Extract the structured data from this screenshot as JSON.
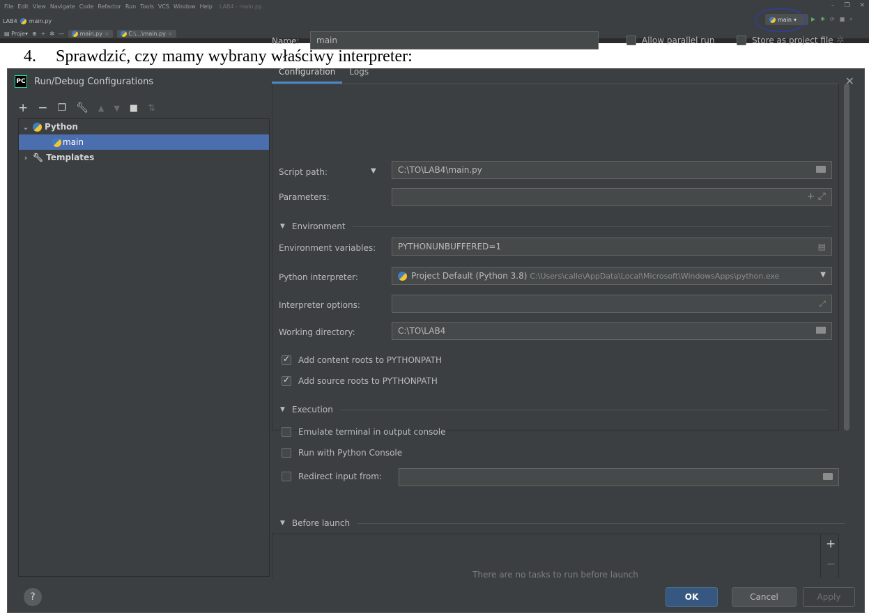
{
  "ide": {
    "menu": [
      "File",
      "Edit",
      "View",
      "Navigate",
      "Code",
      "Refactor",
      "Run",
      "Tools",
      "VCS",
      "Window",
      "Help"
    ],
    "window_title": "LAB4 - main.py",
    "breadcrumb": [
      "LAB4",
      "main.py"
    ],
    "project_label": "Proje",
    "tabs": [
      "main.py",
      "C:\\...\\main.py"
    ],
    "run_config": "main"
  },
  "document": {
    "step_number": "4.",
    "step_text": "Sprawdzić, czy mamy wybrany właściwy interpreter:"
  },
  "dialog": {
    "title": "Run/Debug Configurations",
    "tree": {
      "python": "Python",
      "main": "main",
      "templates": "Templates"
    },
    "name_label": "Name:",
    "name_value": "main",
    "allow_parallel_run": "Allow parallel run",
    "store_as_project_file": "Store as project file",
    "tabs": [
      "Configuration",
      "Logs"
    ],
    "config": {
      "script_path_label": "Script path:",
      "script_path": "C:\\TO\\LAB4\\main.py",
      "parameters_label": "Parameters:",
      "environment_section": "Environment",
      "env_vars_label": "Environment variables:",
      "env_vars": "PYTHONUNBUFFERED=1",
      "interpreter_label": "Python interpreter:",
      "interpreter": "Project Default (Python 3.8)",
      "interpreter_path": "C:\\Users\\calle\\AppData\\Local\\Microsoft\\WindowsApps\\python.exe",
      "interpreter_options_label": "Interpreter options:",
      "working_dir_label": "Working directory:",
      "working_dir": "C:\\TO\\LAB4",
      "add_content_roots": "Add content roots to PYTHONPATH",
      "add_source_roots": "Add source roots to PYTHONPATH",
      "execution_section": "Execution",
      "emulate_terminal": "Emulate terminal in output console",
      "run_with_console": "Run with Python Console",
      "redirect_input": "Redirect input from:"
    },
    "before_launch": {
      "title": "Before launch",
      "empty_text": "There are no tasks to run before launch"
    },
    "buttons": {
      "help": "?",
      "ok": "OK",
      "cancel": "Cancel",
      "apply": "Apply"
    }
  },
  "colors": {
    "dialog_bg": "#3c3f41",
    "selection": "#4b6eaf",
    "primary_button": "#365880",
    "annotation_circle": "#2b3bd0"
  }
}
